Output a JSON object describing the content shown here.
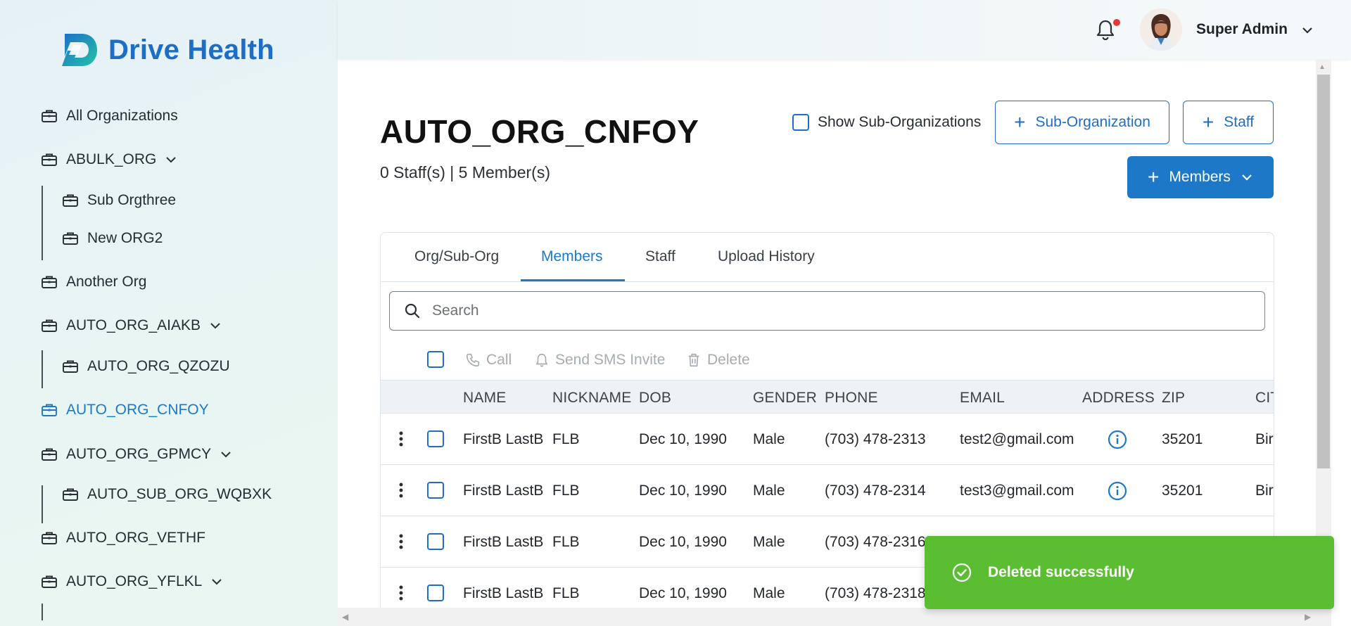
{
  "app": {
    "logo_text": "Drive Health"
  },
  "sidebar": {
    "items": [
      {
        "label": "All Organizations"
      },
      {
        "label": "ABULK_ORG"
      },
      {
        "label": "Sub Orgthree"
      },
      {
        "label": "New ORG2"
      },
      {
        "label": "Another Org"
      },
      {
        "label": "AUTO_ORG_AIAKB"
      },
      {
        "label": "AUTO_ORG_QZOZU"
      },
      {
        "label": "AUTO_ORG_CNFOY"
      },
      {
        "label": "AUTO_ORG_GPMCY"
      },
      {
        "label": "AUTO_SUB_ORG_WQBXK"
      },
      {
        "label": "AUTO_ORG_VETHF"
      },
      {
        "label": "AUTO_ORG_YFLKL"
      }
    ]
  },
  "header": {
    "user_name": "Super Admin",
    "notification_indicator": true
  },
  "org": {
    "title": "AUTO_ORG_CNFOY",
    "counts": "0 Staff(s) | 5 Member(s)",
    "show_sub_label": "Show Sub-Organizations",
    "sub_org_button": "Sub-Organization",
    "staff_button": "Staff",
    "members_button": "Members"
  },
  "tabs": [
    {
      "label": "Org/Sub-Org"
    },
    {
      "label": "Members",
      "active": true
    },
    {
      "label": "Staff"
    },
    {
      "label": "Upload History"
    }
  ],
  "search": {
    "placeholder": "Search"
  },
  "bulk_actions": {
    "call": "Call",
    "sms": "Send SMS Invite",
    "delete": "Delete"
  },
  "table": {
    "columns": [
      "NAME",
      "NICKNAME",
      "DOB",
      "GENDER",
      "PHONE",
      "EMAIL",
      "ADDRESS",
      "ZIP",
      "CIT"
    ],
    "rows": [
      {
        "name": "FirstB LastB",
        "nickname": "FLB",
        "dob": "Dec 10, 1990",
        "gender": "Male",
        "phone": "(703) 478-2313",
        "email": "test2@gmail.com",
        "zip": "35201",
        "city": "Bir"
      },
      {
        "name": "FirstB LastB",
        "nickname": "FLB",
        "dob": "Dec 10, 1990",
        "gender": "Male",
        "phone": "(703) 478-2314",
        "email": "test3@gmail.com",
        "zip": "35201",
        "city": "Bir"
      },
      {
        "name": "FirstB LastB",
        "nickname": "FLB",
        "dob": "Dec 10, 1990",
        "gender": "Male",
        "phone": "(703) 478-2316",
        "email": "",
        "zip": "",
        "city": ""
      },
      {
        "name": "FirstB LastB",
        "nickname": "FLB",
        "dob": "Dec 10, 1990",
        "gender": "Male",
        "phone": "(703) 478-2318",
        "email": "",
        "zip": "",
        "city": ""
      }
    ]
  },
  "toast": {
    "message": "Deleted successfully"
  },
  "colors": {
    "brand": "#1e78c8",
    "success": "#5bbd32",
    "alert": "#e53935"
  },
  "icons": {
    "nav": "briefcase-icon",
    "notifications": "bell-icon",
    "toast": "check-circle-icon",
    "address": "info-icon"
  }
}
